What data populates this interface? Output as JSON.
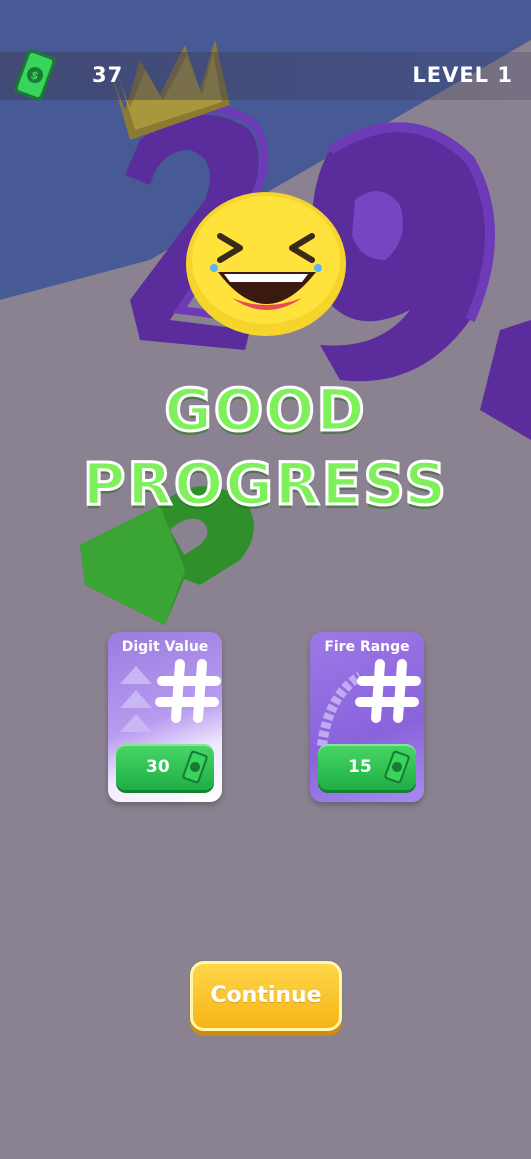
{
  "hud": {
    "cash_icon": "cash-icon",
    "cash_count": "37",
    "level_label": "LEVEL 1"
  },
  "scene": {
    "emoji": "laughing-face-icon",
    "background_objects": [
      "crowned-purple-digit-2",
      "purple-digit-9",
      "green-digit-2"
    ]
  },
  "headline": {
    "line1": "GOOD",
    "line2": "PROGRESS"
  },
  "upgrades": [
    {
      "title": "Digit Value",
      "icon": "hash-icon",
      "price": "30",
      "currency_icon": "cash-icon"
    },
    {
      "title": "Fire Range",
      "icon": "hash-icon",
      "price": "15",
      "currency_icon": "cash-icon"
    }
  ],
  "continue_label": "Continue",
  "colors": {
    "headline": "#7df05a",
    "price_button": "#2ec552",
    "continue_button": "#f8c224",
    "card_purple": "#9a7be0",
    "digit_purple": "#5a2c9c",
    "digit_green": "#2f8f2a"
  }
}
